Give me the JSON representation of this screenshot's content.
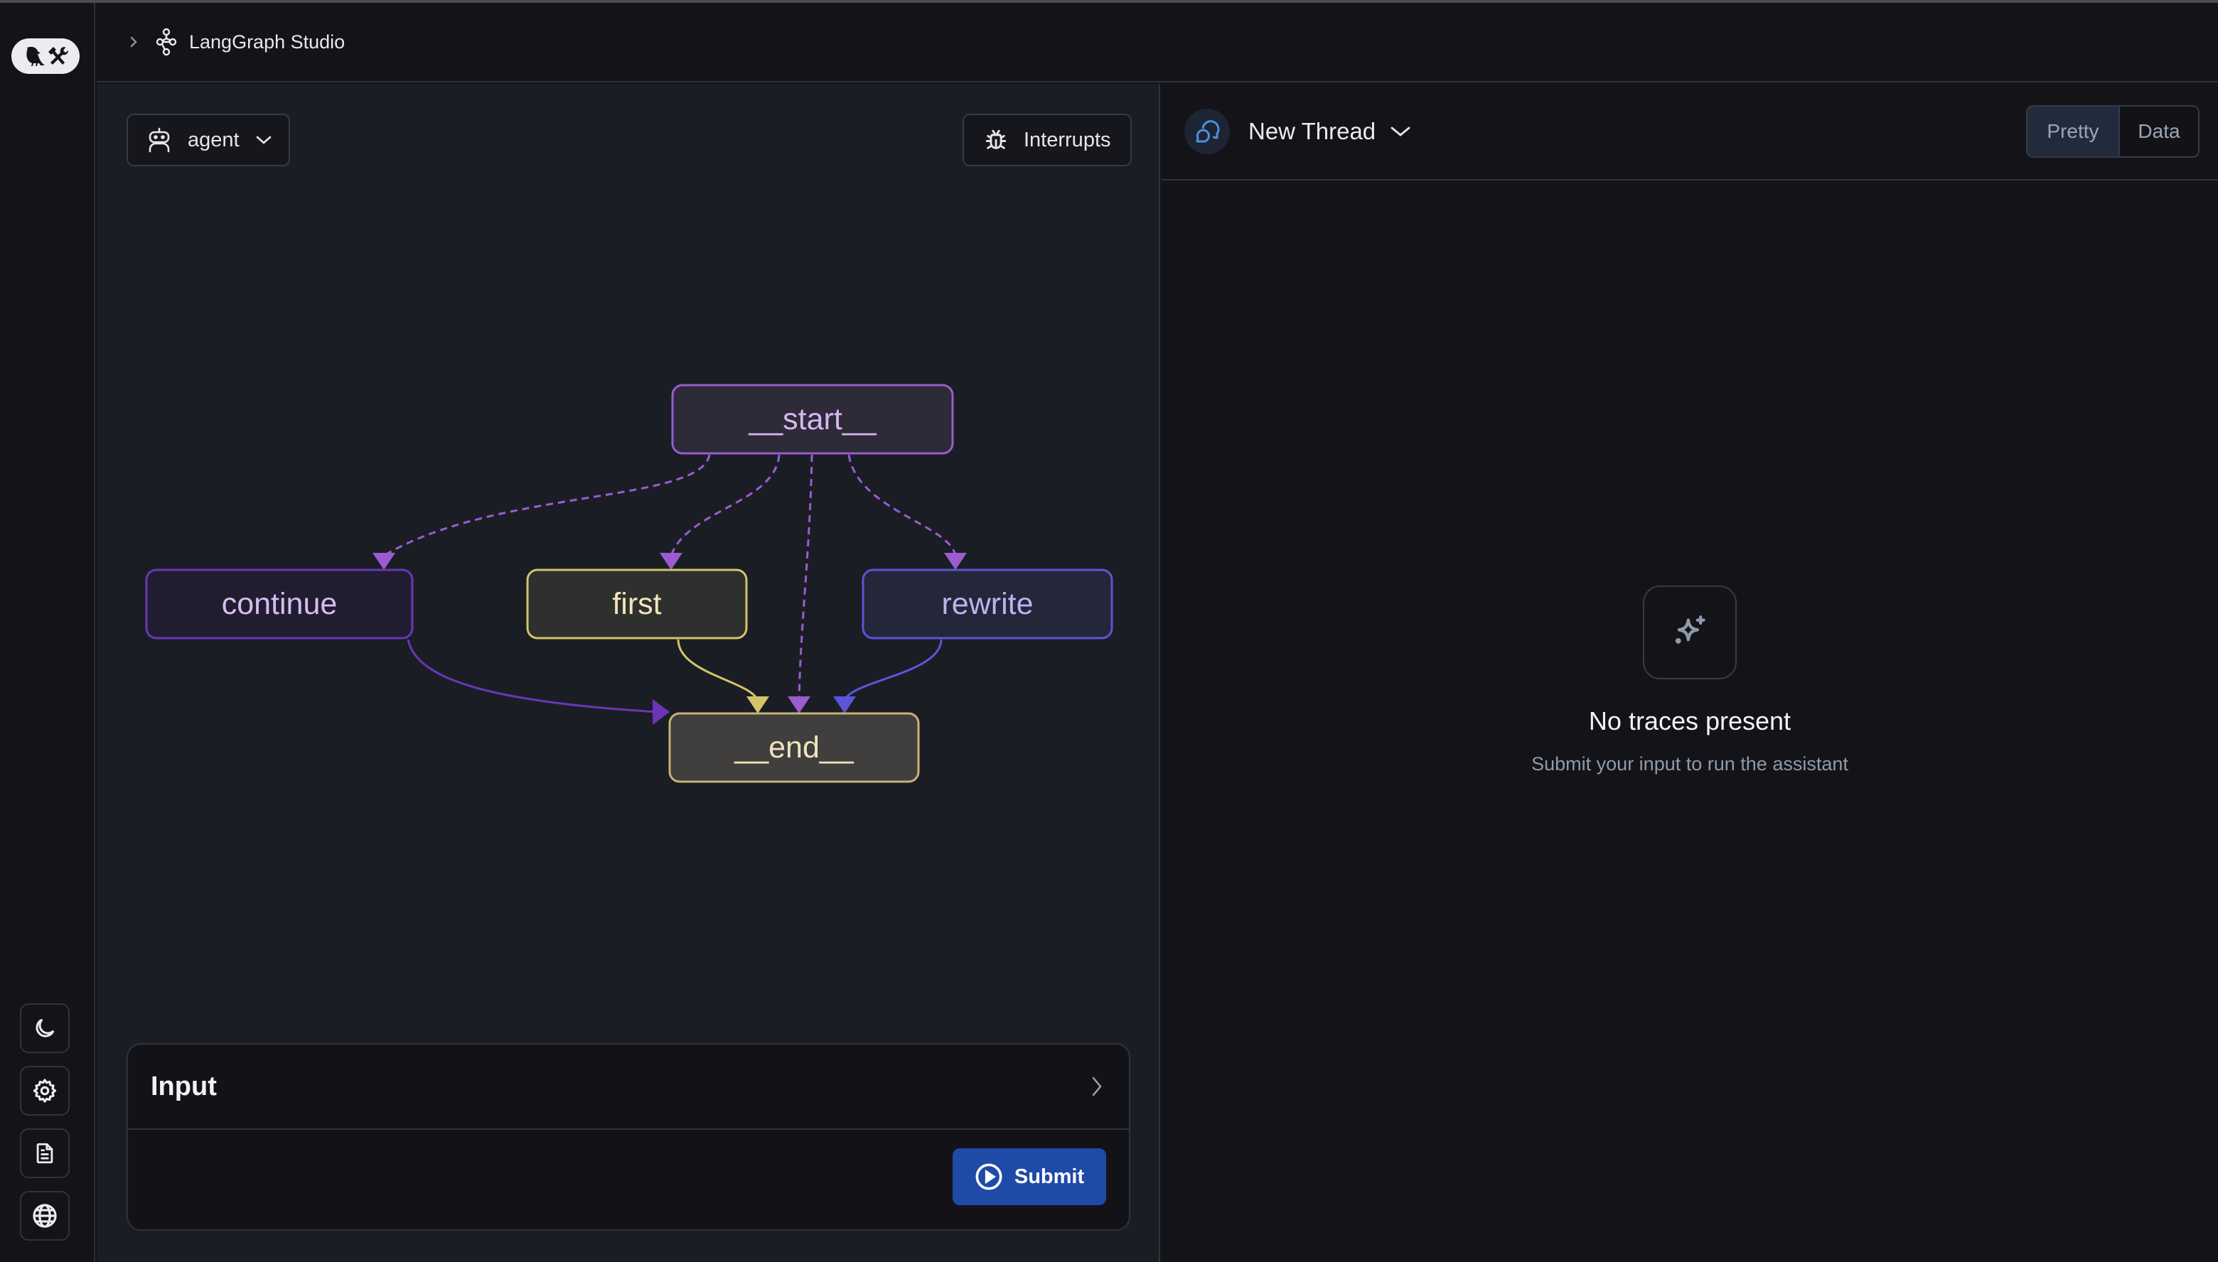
{
  "app": {
    "title": "LangGraph Studio",
    "logo": "langgraph-parrot-tools-logo"
  },
  "rail": {
    "items": [
      {
        "icon": "moon-icon",
        "label": "Toggle theme"
      },
      {
        "icon": "gear-icon",
        "label": "Settings"
      },
      {
        "icon": "document-icon",
        "label": "Docs"
      },
      {
        "icon": "globe-icon",
        "label": "Web"
      }
    ]
  },
  "graph_panel": {
    "graph_select": {
      "value": "agent",
      "icon": "robot-icon"
    },
    "interrupts_label": "Interrupts",
    "nodes": [
      {
        "id": "start",
        "label": "__start__",
        "stroke": "#9a5cd0",
        "fill": "#2c2b37",
        "text": "#d9b5f0"
      },
      {
        "id": "continue",
        "label": "continue",
        "stroke": "#6b35b8",
        "fill": "#211d30",
        "text": "#d5bdf0"
      },
      {
        "id": "first",
        "label": "first",
        "stroke": "#d4c46a",
        "fill": "#2e302e",
        "text": "#efe6b8"
      },
      {
        "id": "rewrite",
        "label": "rewrite",
        "stroke": "#5b55d8",
        "fill": "#24263a",
        "text": "#b9b5f2"
      },
      {
        "id": "end",
        "label": "__end__",
        "stroke": "#c9b273",
        "fill": "#403f3e",
        "text": "#efe3c0"
      }
    ],
    "edges": [
      {
        "from": "start",
        "to": "continue",
        "style": "dashed",
        "color": "#9a5cd0"
      },
      {
        "from": "start",
        "to": "first",
        "style": "dashed",
        "color": "#9a5cd0"
      },
      {
        "from": "start",
        "to": "end",
        "style": "dashed",
        "color": "#9a5cd0"
      },
      {
        "from": "start",
        "to": "rewrite",
        "style": "dashed",
        "color": "#9a5cd0"
      },
      {
        "from": "continue",
        "to": "end",
        "style": "solid",
        "color": "#6b35b8"
      },
      {
        "from": "first",
        "to": "end",
        "style": "solid",
        "color": "#d4c46a"
      },
      {
        "from": "rewrite",
        "to": "end",
        "style": "solid",
        "color": "#5b55d8"
      }
    ],
    "input": {
      "title": "Input",
      "submit_label": "Submit"
    }
  },
  "thread_panel": {
    "thread_title": "New Thread",
    "view_toggle": {
      "options": [
        "Pretty",
        "Data"
      ],
      "selected": "Pretty"
    },
    "empty_state": {
      "title": "No traces present",
      "subtitle": "Submit your input to run the assistant"
    }
  },
  "colors": {
    "accent_submit": "#1f4aa8",
    "thread_icon": "#4a90e2"
  }
}
